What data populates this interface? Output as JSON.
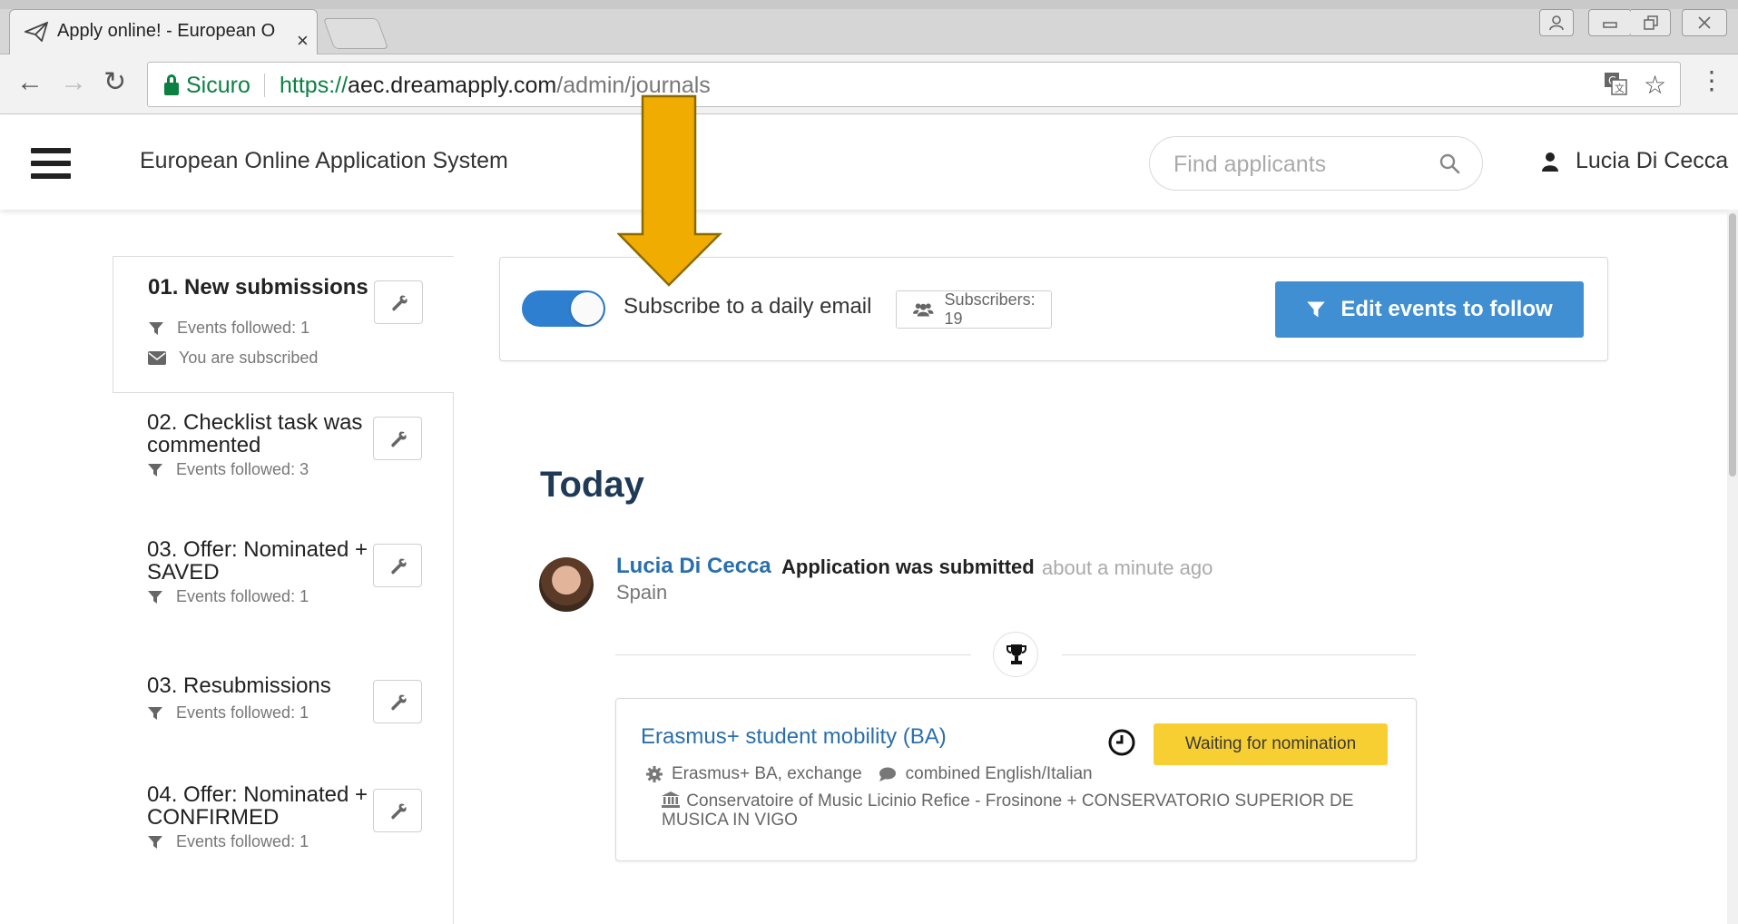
{
  "browser": {
    "tab_title": "Apply online! - European O",
    "tab_close": "×",
    "secure_label": "Sicuro",
    "url_scheme": "https://",
    "url_host": "aec.dreamapply.com",
    "url_path": "/admin/journals"
  },
  "header": {
    "app_title": "European Online Application System",
    "search_placeholder": "Find applicants",
    "user_name": "Lucia Di Cecca"
  },
  "sidebar": {
    "journals": [
      {
        "title": "01. New submissions",
        "meta": [
          "Events followed: 1",
          "You are subscribed"
        ]
      },
      {
        "title": "02. Checklist task was commented",
        "meta": [
          "Events followed: 3"
        ]
      },
      {
        "title": "03. Offer: Nominated + SAVED",
        "meta": [
          "Events followed: 1"
        ]
      },
      {
        "title": "03. Resubmissions",
        "meta": [
          "Events followed: 1"
        ]
      },
      {
        "title": "04. Offer: Nominated + CONFIRMED",
        "meta": [
          "Events followed: 1"
        ]
      }
    ]
  },
  "subscribe": {
    "label": "Subscribe to a daily email",
    "enabled": true,
    "subscribers": "Subscribers: 19",
    "edit_button": "Edit events to follow"
  },
  "feed": {
    "section": "Today",
    "entry": {
      "name": "Lucia Di Cecca",
      "event": "Application was submitted",
      "time": "about a minute ago",
      "country": "Spain"
    },
    "card": {
      "title": "Erasmus+ student mobility (BA)",
      "status": "Waiting for nomination",
      "program": "Erasmus+ BA, exchange",
      "language": "combined English/Italian",
      "institutions": "Conservatoire of Music Licinio Refice - Frosinone + CONSERVATORIO SUPERIOR DE MUSICA IN VIGO"
    }
  },
  "colors": {
    "accent": "#3f8fd2",
    "toggle": "#2e7fcf",
    "status_badge": "#f8cf33",
    "annotation_arrow": "#f0ac00",
    "heading": "#1f3a57"
  }
}
